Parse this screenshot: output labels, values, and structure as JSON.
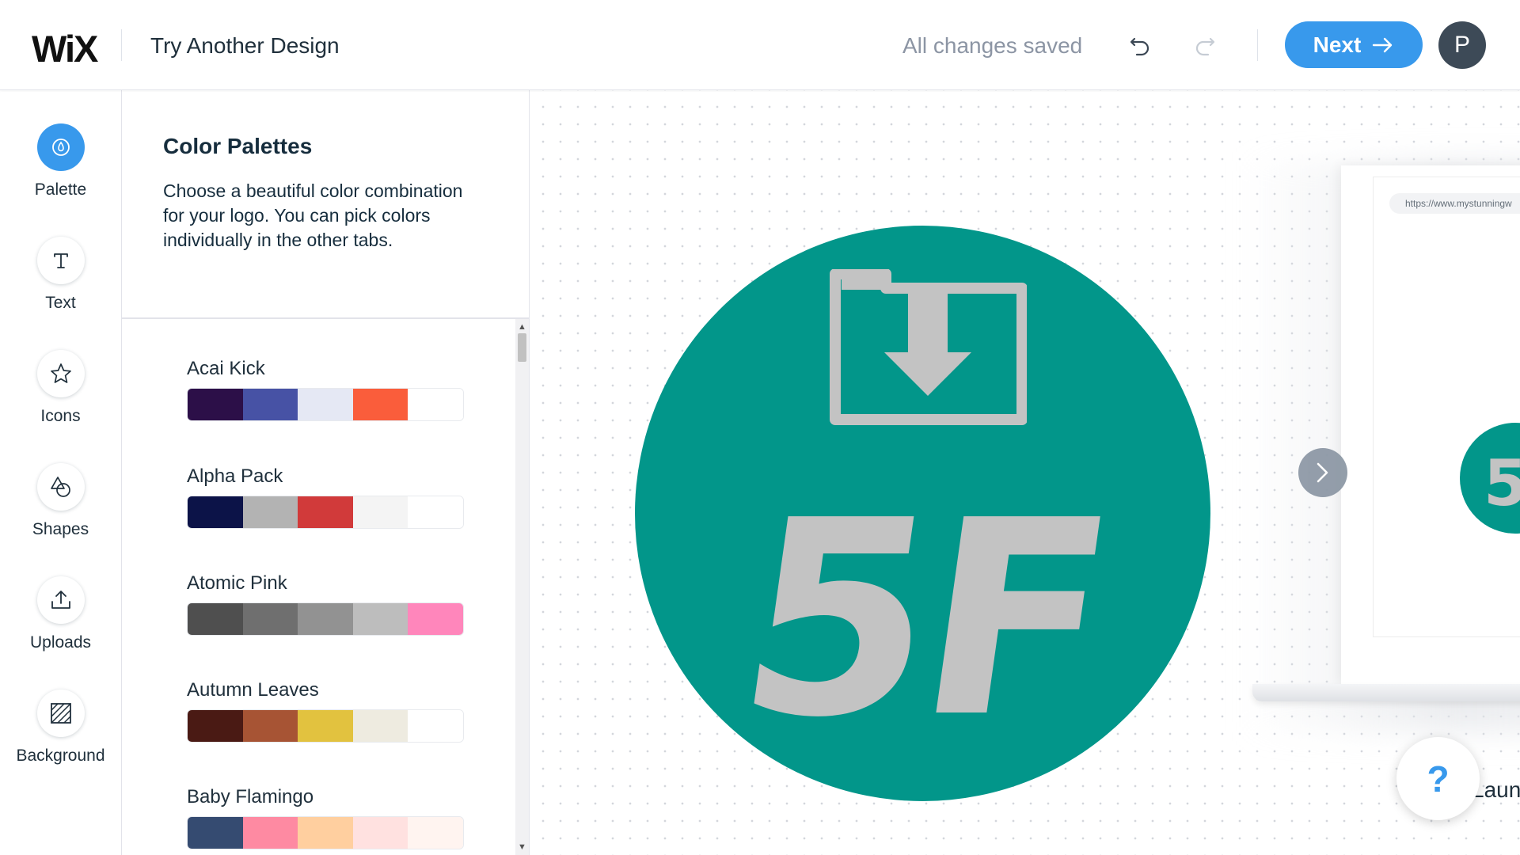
{
  "header": {
    "logo": "WiX",
    "title": "Try Another Design",
    "status": "All changes saved",
    "next_label": "Next",
    "avatar_initial": "P"
  },
  "rail": {
    "items": [
      {
        "label": "Palette",
        "icon": "palette-drop-icon",
        "active": true
      },
      {
        "label": "Text",
        "icon": "text-icon"
      },
      {
        "label": "Icons",
        "icon": "star-icon"
      },
      {
        "label": "Shapes",
        "icon": "shapes-icon"
      },
      {
        "label": "Uploads",
        "icon": "upload-icon"
      },
      {
        "label": "Background",
        "icon": "background-hatch-icon"
      }
    ]
  },
  "panel": {
    "title": "Color Palettes",
    "description": "Choose a beautiful color combination for your logo. You can pick colors individually in the other tabs.",
    "palettes": [
      {
        "name": "Acai Kick",
        "colors": [
          "#2c0f48",
          "#4752a5",
          "#e5e8f4",
          "#fa5d3b",
          "#ffffff"
        ]
      },
      {
        "name": "Alpha Pack",
        "colors": [
          "#0c1348",
          "#b3b3b3",
          "#d13a3a",
          "#f4f4f4",
          "#ffffff"
        ]
      },
      {
        "name": "Atomic Pink",
        "colors": [
          "#4f4f4f",
          "#6f6f6f",
          "#929292",
          "#bdbdbd",
          "#ff86bb"
        ]
      },
      {
        "name": "Autumn Leaves",
        "colors": [
          "#4a1a14",
          "#a75434",
          "#e2c23f",
          "#eeebe0",
          "#ffffff"
        ]
      },
      {
        "name": "Baby Flamingo",
        "colors": [
          "#354b71",
          "#fe8aa2",
          "#ffcf9f",
          "#ffe1e0",
          "#fff4f0"
        ]
      }
    ]
  },
  "canvas": {
    "logo_text": "5F",
    "logo_bg_color": "#02968a",
    "logo_fg_color": "#c3c3c3",
    "preview_url": "https://www.mystunningw",
    "preview_logo_text": "5",
    "launch_text": "Laun",
    "help_label": "?"
  }
}
